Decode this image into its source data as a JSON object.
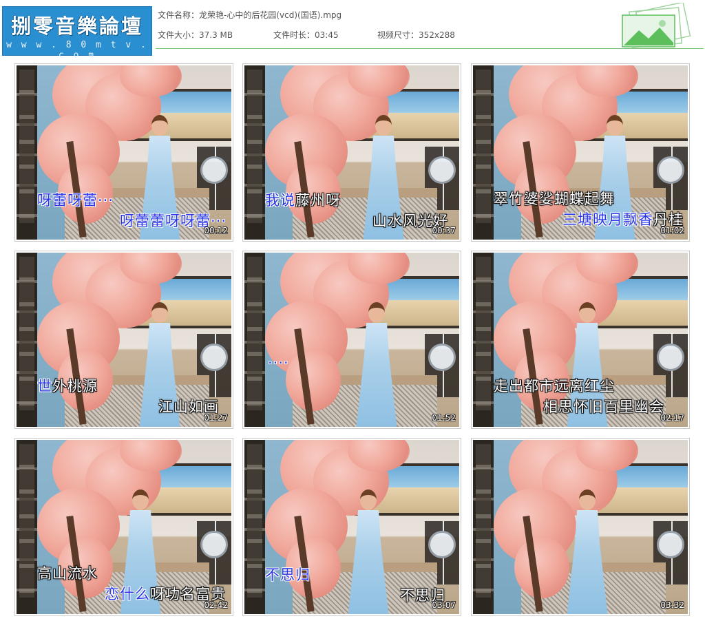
{
  "logo": {
    "title": "捌零音樂論壇",
    "url": "w w w . 8 0 m t v . c o m"
  },
  "file_info": {
    "name_label": "文件名称：",
    "name_value": "龙荣艳-心中的后花园(vcd)(国语).mpg",
    "size_label": "文件大小：",
    "size_value": "37.3 MB",
    "duration_label": "文件时长：",
    "duration_value": "03:45",
    "dims_label": "视频尺寸：",
    "dims_value": "352x288"
  },
  "colors": {
    "header_line": "#7dc37d",
    "logo_bg": "#2a8fd0",
    "lyric_highlight": "#2a36e6"
  },
  "decoration_icon": "green-picture-frames-icon",
  "thumbnails": [
    {
      "timestamp": "00:12",
      "line1_hl": "呀蕾呀蕾···",
      "line1_rest": "",
      "line2_hl": "呀蕾蕾呀呀蕾···",
      "line2_rest": ""
    },
    {
      "timestamp": "00:37",
      "line1_hl": "我说",
      "line1_rest": "藤州呀",
      "line2_hl": "",
      "line2_rest": "山水风光好"
    },
    {
      "timestamp": "01:02",
      "line1_hl": "",
      "line1_rest": "翠竹婆娑蝴蝶起舞",
      "line2_hl": "三塘映月飘香",
      "line2_rest": "丹桂"
    },
    {
      "timestamp": "01:27",
      "line1_hl": "世",
      "line1_rest": "外桃源",
      "line2_hl": "",
      "line2_rest": "江山如画"
    },
    {
      "timestamp": "01:52",
      "line1_hl": "····",
      "line1_rest": "",
      "line2_hl": "",
      "line2_rest": ""
    },
    {
      "timestamp": "02:17",
      "line1_hl": "",
      "line1_rest": "走出都市远离红尘",
      "line2_hl": "",
      "line2_rest": "相思怀旧百里幽会"
    },
    {
      "timestamp": "02:42",
      "line1_hl": "",
      "line1_rest": "高山流水",
      "line2_hl": "恋什么",
      "line2_rest": "呀功名富贵"
    },
    {
      "timestamp": "03:07",
      "line1_hl": "不思归",
      "line1_rest": "",
      "line2_hl": "",
      "line2_rest": "不思归"
    },
    {
      "timestamp": "03:32",
      "line1_hl": "",
      "line1_rest": "",
      "line2_hl": "",
      "line2_rest": ""
    }
  ]
}
